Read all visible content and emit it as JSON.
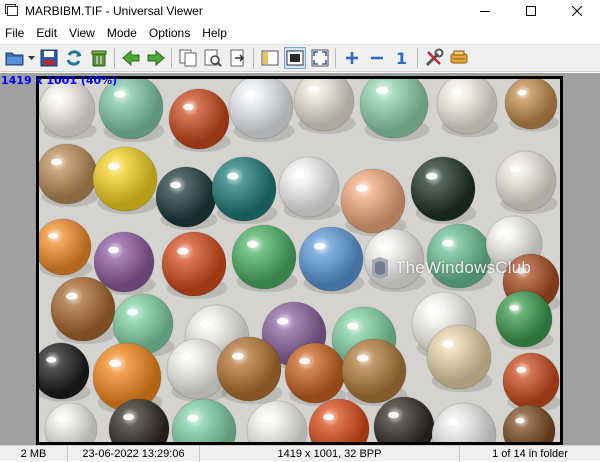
{
  "window": {
    "title": "MARBIBM.TIF - Universal Viewer"
  },
  "menu": [
    "File",
    "Edit",
    "View",
    "Mode",
    "Options",
    "Help"
  ],
  "toolbar": {
    "buttons": [
      "open-folder-icon",
      "save-icon",
      "refresh-icon",
      "recycle-bin-icon",
      "arrow-left-icon",
      "arrow-right-icon",
      "copy-icon",
      "zoom-page-icon",
      "export-icon",
      "panel-icon",
      "fit-window-icon",
      "fullscreen-icon",
      "zoom-in-icon",
      "zoom-out-icon",
      "actual-size-icon",
      "tools-icon",
      "plugin-icon"
    ],
    "actual_size_label": "1"
  },
  "viewer": {
    "dimensions_overlay": "1419 x 1001 (40%)",
    "watermark": "TheWindowsClub"
  },
  "status": {
    "file_size": "2 MB",
    "datetime": "23-06-2022 13:29:06",
    "image_info": "1419 x 1001, 32 BPP",
    "position": "1 of 14 in folder"
  },
  "colors": {
    "overlay_text": "#0000ff",
    "viewport_bg": "#a0a0a0"
  }
}
